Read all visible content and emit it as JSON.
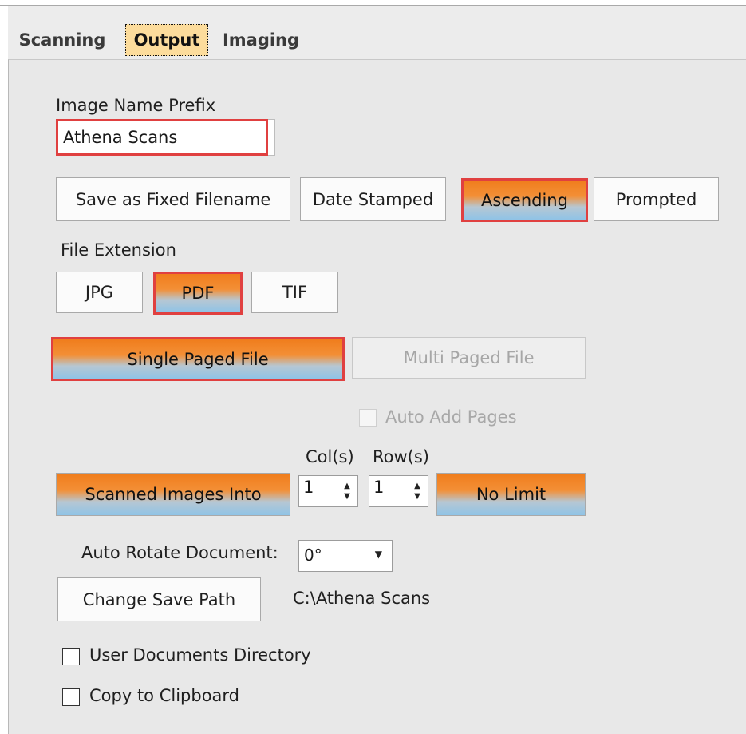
{
  "tabs": [
    {
      "label": "Scanning"
    },
    {
      "label": "Output"
    },
    {
      "label": "Imaging"
    }
  ],
  "image_name_prefix": {
    "label": "Image Name Prefix",
    "value": "Athena Scans"
  },
  "naming_buttons": [
    {
      "label": "Save as Fixed Filename"
    },
    {
      "label": "Date Stamped"
    },
    {
      "label": "Ascending"
    },
    {
      "label": "Prompted"
    }
  ],
  "file_extension": {
    "label": "File Extension",
    "options": [
      {
        "label": "JPG"
      },
      {
        "label": "PDF"
      },
      {
        "label": "TIF"
      }
    ]
  },
  "page_mode": {
    "single": "Single Paged File",
    "multi": "Multi Paged File"
  },
  "auto_add_pages": {
    "label": "Auto Add Pages"
  },
  "grid": {
    "cols_label": "Col(s)",
    "rows_label": "Row(s)",
    "into_label": "Scanned Images Into",
    "cols_value": "1",
    "rows_value": "1",
    "limit_label": "No Limit"
  },
  "auto_rotate": {
    "label": "Auto Rotate Document:",
    "value": "0°"
  },
  "save_path": {
    "button": "Change Save Path",
    "path": "C:\\Athena Scans"
  },
  "options": {
    "user_docs": "User Documents Directory",
    "clipboard": "Copy to Clipboard"
  },
  "colors": {
    "selected_top": "#f07d1c",
    "selected_bottom": "#8fc3e6",
    "highlight_border": "#e04040",
    "active_tab": "#fcdc9c"
  }
}
